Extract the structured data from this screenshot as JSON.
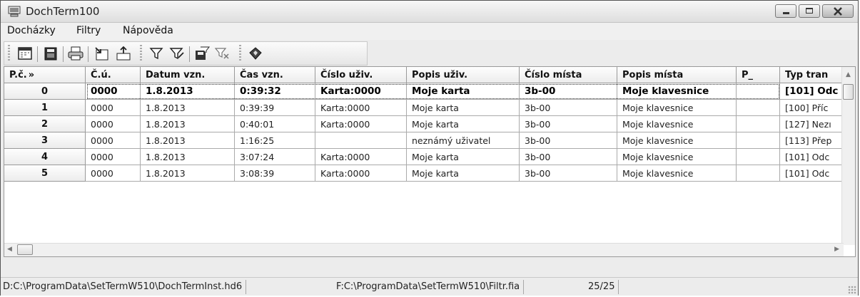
{
  "window": {
    "title": "DochTerm100"
  },
  "menu": [
    {
      "label": "Docházky"
    },
    {
      "label": "Filtry"
    },
    {
      "label": "Nápověda"
    }
  ],
  "toolbar": {
    "icons": [
      "calendar-icon",
      "memory-card-icon",
      "printer-icon",
      "export-icon",
      "import-icon",
      "filter-icon",
      "filter-edit-icon",
      "filter-save-icon",
      "filter-clear-icon",
      "about-icon"
    ]
  },
  "grid": {
    "columns": [
      "P.č.",
      "Č.ú.",
      "Datum vzn.",
      "Čas vzn.",
      "Číslo uživ.",
      "Popis uživ.",
      "Číslo místa",
      "Popis místa",
      "P_",
      "Typ tran"
    ],
    "sort_indicator": "»",
    "rows": [
      {
        "num": "0",
        "cells": [
          "0000",
          "1.8.2013",
          "0:39:32",
          "Karta:0000",
          "Moje karta",
          "3b-00",
          "Moje klavesnice",
          "",
          "[101] Odc"
        ],
        "selected": true
      },
      {
        "num": "1",
        "cells": [
          "0000",
          "1.8.2013",
          "0:39:39",
          "Karta:0000",
          "Moje karta",
          "3b-00",
          "Moje klavesnice",
          "",
          "[100] Příc"
        ]
      },
      {
        "num": "2",
        "cells": [
          "0000",
          "1.8.2013",
          "0:40:01",
          "Karta:0000",
          "Moje karta",
          "3b-00",
          "Moje klavesnice",
          "",
          "[127] Nezı"
        ]
      },
      {
        "num": "3",
        "cells": [
          "0000",
          "1.8.2013",
          "1:16:25",
          "",
          "neznámý uživatel",
          "3b-00",
          "Moje klavesnice",
          "",
          "[113] Přep"
        ]
      },
      {
        "num": "4",
        "cells": [
          "0000",
          "1.8.2013",
          "3:07:24",
          "Karta:0000",
          "Moje karta",
          "3b-00",
          "Moje klavesnice",
          "",
          "[101] Odc"
        ]
      },
      {
        "num": "5",
        "cells": [
          "0000",
          "1.8.2013",
          "3:08:39",
          "Karta:0000",
          "Moje karta",
          "3b-00",
          "Moje klavesnice",
          "",
          "[101] Odc"
        ]
      }
    ]
  },
  "status": {
    "database": "D:C:\\ProgramData\\SetTermW510\\DochTermInst.hd6",
    "filter": "F:C:\\ProgramData\\SetTermW510\\Filtr.fia",
    "count": "25/25"
  }
}
